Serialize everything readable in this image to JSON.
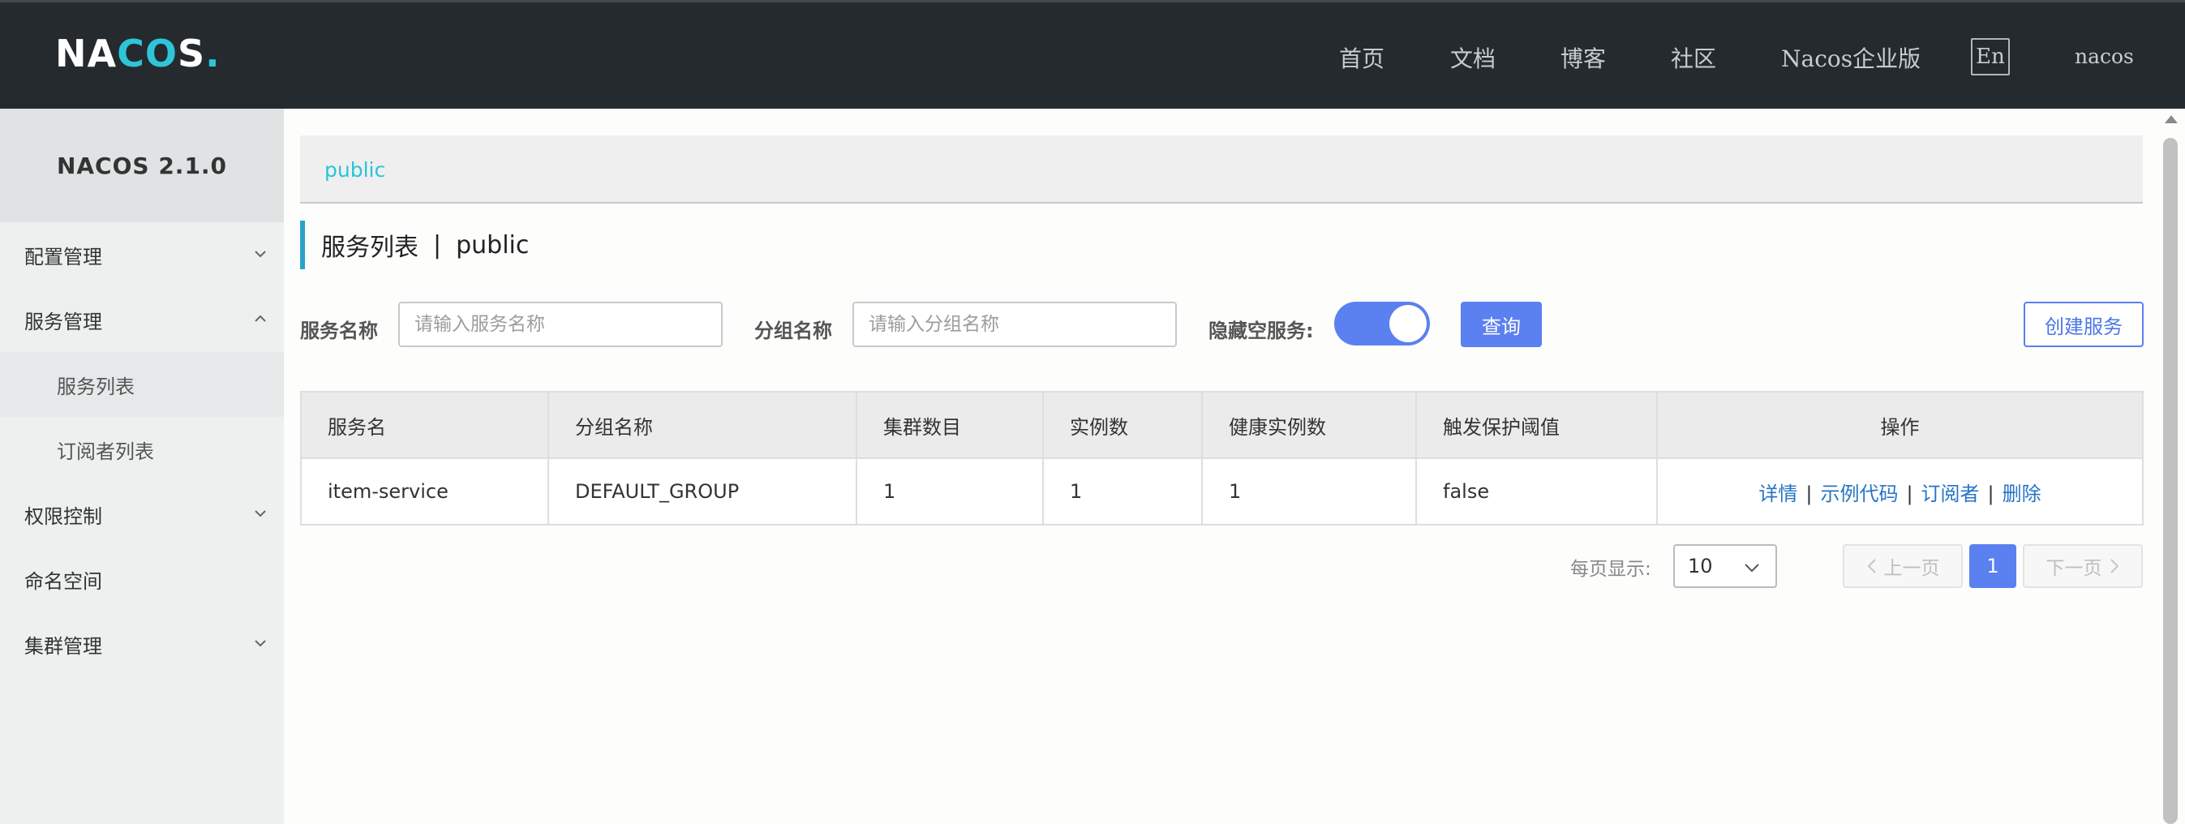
{
  "header": {
    "logo": {
      "part1": "NA",
      "part2": "C",
      "part3": "O",
      "part4": "S",
      "dot": "."
    },
    "nav": [
      "首页",
      "文档",
      "博客",
      "社区",
      "Nacos企业版"
    ],
    "lang": "En",
    "user": "nacos"
  },
  "sidebar": {
    "title": "NACOS 2.1.0",
    "items": [
      {
        "label": "配置管理",
        "icon": "chevron-down-icon"
      },
      {
        "label": "服务管理",
        "icon": "chevron-up-icon"
      },
      {
        "label": "服务列表"
      },
      {
        "label": "订阅者列表"
      },
      {
        "label": "权限控制",
        "icon": "chevron-down-icon"
      },
      {
        "label": "命名空间"
      },
      {
        "label": "集群管理",
        "icon": "chevron-down-icon"
      }
    ]
  },
  "namespace": {
    "current": "public"
  },
  "page": {
    "title": "服务列表",
    "separator": "|",
    "namespace": "public"
  },
  "filters": {
    "service_name_label": "服务名称",
    "service_name_placeholder": "请输入服务名称",
    "group_name_label": "分组名称",
    "group_name_placeholder": "请输入分组名称",
    "hide_empty_label": "隐藏空服务:",
    "hide_empty_on": true,
    "query_button": "查询",
    "create_button": "创建服务"
  },
  "table": {
    "columns": [
      "服务名",
      "分组名称",
      "集群数目",
      "实例数",
      "健康实例数",
      "触发保护阈值",
      "操作"
    ],
    "rows": [
      {
        "service": "item-service",
        "group": "DEFAULT_GROUP",
        "clusters": "1",
        "instances": "1",
        "healthy": "1",
        "threshold": "false"
      }
    ],
    "actions": [
      "详情",
      "示例代码",
      "订阅者",
      "删除"
    ],
    "action_separator": "|"
  },
  "pagination": {
    "page_size_label": "每页显示:",
    "page_size": "10",
    "prev": "上一页",
    "current": "1",
    "next": "下一页"
  },
  "colors": {
    "header_bg": "#252a2f",
    "accent": "#5b80f0",
    "namespace_link": "#27c5d8",
    "action_link": "#2774c5"
  }
}
